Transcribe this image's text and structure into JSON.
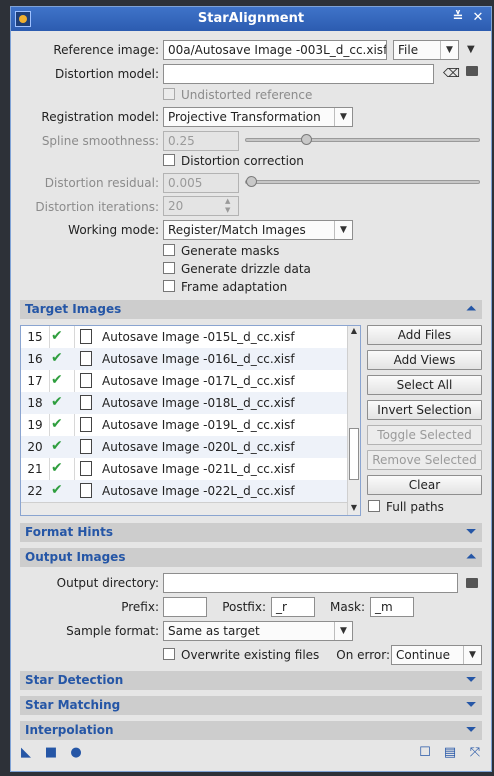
{
  "window": {
    "title": "StarAlignment"
  },
  "reference_image": {
    "label": "Reference image:",
    "value": "00a/Autosave Image -003L_d_cc.xisf",
    "mode": "File"
  },
  "distortion_model": {
    "label": "Distortion model:",
    "value": ""
  },
  "undistorted_reference": {
    "label": "Undistorted reference",
    "checked": false,
    "enabled": false
  },
  "registration_model": {
    "label": "Registration model:",
    "value": "Projective Transformation"
  },
  "spline_smoothness": {
    "label": "Spline smoothness:",
    "value": "0.25",
    "enabled": false
  },
  "distortion_correction": {
    "label": "Distortion correction",
    "checked": false
  },
  "distortion_residual": {
    "label": "Distortion residual:",
    "value": "0.005",
    "enabled": false
  },
  "distortion_iterations": {
    "label": "Distortion iterations:",
    "value": "20",
    "enabled": false
  },
  "working_mode": {
    "label": "Working mode:",
    "value": "Register/Match Images"
  },
  "generate_masks": {
    "label": "Generate masks",
    "checked": false
  },
  "generate_drizzle": {
    "label": "Generate drizzle data",
    "checked": false
  },
  "frame_adaptation": {
    "label": "Frame adaptation",
    "checked": false
  },
  "target_images": {
    "title": "Target Images",
    "rows": [
      {
        "index": "15",
        "file": "Autosave Image -015L_d_cc.xisf"
      },
      {
        "index": "16",
        "file": "Autosave Image -016L_d_cc.xisf"
      },
      {
        "index": "17",
        "file": "Autosave Image -017L_d_cc.xisf"
      },
      {
        "index": "18",
        "file": "Autosave Image -018L_d_cc.xisf"
      },
      {
        "index": "19",
        "file": "Autosave Image -019L_d_cc.xisf"
      },
      {
        "index": "20",
        "file": "Autosave Image -020L_d_cc.xisf"
      },
      {
        "index": "21",
        "file": "Autosave Image -021L_d_cc.xisf"
      },
      {
        "index": "22",
        "file": "Autosave Image -022L_d_cc.xisf"
      }
    ],
    "buttons": {
      "add_files": "Add Files",
      "add_views": "Add Views",
      "select_all": "Select All",
      "invert_selection": "Invert Selection",
      "toggle_selected": "Toggle Selected",
      "remove_selected": "Remove Selected",
      "clear": "Clear"
    },
    "full_paths": {
      "label": "Full paths",
      "checked": false
    }
  },
  "format_hints": {
    "title": "Format Hints"
  },
  "output_images": {
    "title": "Output Images",
    "output_directory": {
      "label": "Output directory:",
      "value": ""
    },
    "prefix": {
      "label": "Prefix:",
      "value": ""
    },
    "postfix": {
      "label": "Postfix:",
      "value": "_r"
    },
    "mask": {
      "label": "Mask:",
      "value": "_m"
    },
    "sample_format": {
      "label": "Sample format:",
      "value": "Same as target"
    },
    "overwrite": {
      "label": "Overwrite existing files",
      "checked": false
    },
    "on_error": {
      "label": "On error:",
      "value": "Continue"
    }
  },
  "star_detection": {
    "title": "Star Detection"
  },
  "star_matching": {
    "title": "Star Matching"
  },
  "interpolation": {
    "title": "Interpolation"
  },
  "colors": {
    "title_bar": "#3f73c9",
    "section_text": "#2556a6",
    "check_green": "#2e9e3e"
  }
}
